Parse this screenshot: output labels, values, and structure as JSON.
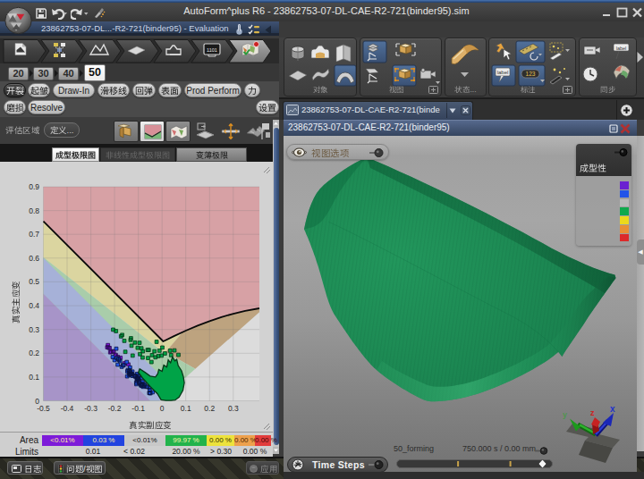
{
  "window": {
    "title": "AutoForm^plus R6 - 23862753-07-DL-CAE-R2-721(binder95).sim",
    "controls": {
      "minimize": "–",
      "maximize": "□",
      "close": "✕"
    }
  },
  "quick_toolbar": {
    "icons": [
      "save",
      "undo",
      "redo",
      "reset-highlights"
    ]
  },
  "eval_bar": {
    "title": "23862753-07-DL...-R2-721(binder95) - Evaluation"
  },
  "process_steps": [
    "input-files",
    "process-plan",
    "part",
    "blank",
    "tool-setup",
    "simulation-1101",
    "results-evaluation"
  ],
  "process_monitor_text": "1101",
  "stage_tabs": {
    "items": [
      "20",
      "30",
      "40",
      "50"
    ],
    "active": "50"
  },
  "result_buttons": {
    "row1": [
      {
        "label": "开裂",
        "active": true
      },
      {
        "label": "起皱",
        "active": false
      },
      {
        "label": "Draw-In",
        "active": false
      },
      {
        "label": "滑移线",
        "active": false
      },
      {
        "label": "回弹",
        "active": false
      },
      {
        "label": "表面",
        "active": false
      },
      {
        "label": "Prod Perform",
        "active": false
      },
      {
        "label": "力",
        "active": false
      }
    ],
    "row2": [
      {
        "label": "磨损",
        "active": false
      },
      {
        "label": "Resolve",
        "active": false
      }
    ],
    "settings": "设置"
  },
  "eval_region": {
    "label": "评估区域",
    "define_button": "定义...",
    "icons": [
      "iso-view",
      "fld-diagram",
      "fld-map",
      "section-sheet",
      "section-cross",
      "smileys-sheet",
      "marker-flag"
    ]
  },
  "chart_tabs": [
    {
      "label": "成型极限图",
      "state": "active"
    },
    {
      "label": "非线性成型极限图",
      "state": "disabled"
    },
    {
      "label": "变薄极限",
      "state": "normal"
    }
  ],
  "chart_data": {
    "type": "scatter",
    "title": "成型极限图",
    "xlabel": "真实副应变",
    "ylabel": "真实主应变",
    "xlim": [
      -0.5,
      0.41
    ],
    "ylim": [
      0,
      0.9
    ],
    "xticks": [
      -0.5,
      -0.4,
      -0.3,
      -0.2,
      -0.1,
      0,
      0.1,
      0.2,
      0.3
    ],
    "yticks": [
      0,
      0.1,
      0.2,
      0.3,
      0.4,
      0.5,
      0.6,
      0.7,
      0.8,
      0.9
    ],
    "grid": true,
    "flc": [
      [
        -0.5,
        0.755
      ],
      [
        0.005,
        0.25
      ],
      [
        0.05,
        0.272
      ],
      [
        0.1,
        0.295
      ],
      [
        0.15,
        0.316
      ],
      [
        0.2,
        0.335
      ],
      [
        0.25,
        0.352
      ],
      [
        0.3,
        0.366
      ],
      [
        0.35,
        0.378
      ],
      [
        0.41,
        0.389
      ]
    ],
    "regions": [
      {
        "name": "splits",
        "color": "#d7a1a5",
        "points": [
          [
            -0.5,
            0.9
          ],
          [
            -0.5,
            0.755
          ],
          [
            0.005,
            0.25
          ],
          [
            0.05,
            0.272
          ],
          [
            0.1,
            0.295
          ],
          [
            0.15,
            0.316
          ],
          [
            0.2,
            0.335
          ],
          [
            0.25,
            0.352
          ],
          [
            0.3,
            0.366
          ],
          [
            0.35,
            0.378
          ],
          [
            0.41,
            0.389
          ],
          [
            0.41,
            0.9
          ]
        ]
      },
      {
        "name": "risk-of-splits-left",
        "color": "#dbd5a0",
        "points": [
          [
            -0.5,
            0.755
          ],
          [
            0.005,
            0.25
          ],
          [
            0.01,
            0.2
          ],
          [
            -0.5,
            0.604
          ]
        ]
      },
      {
        "name": "risk-of-splits-right",
        "color": "#dbd5a0",
        "points": [
          [
            0.005,
            0.25
          ],
          [
            0.05,
            0.272
          ],
          [
            0.085,
            0.287
          ],
          [
            0.015,
            0.205
          ],
          [
            0.01,
            0.2
          ]
        ]
      },
      {
        "name": "bending",
        "color": "#bda37f",
        "points": [
          [
            0.085,
            0.287
          ],
          [
            0.1,
            0.295
          ],
          [
            0.15,
            0.316
          ],
          [
            0.2,
            0.335
          ],
          [
            0.25,
            0.352
          ],
          [
            0.3,
            0.366
          ],
          [
            0.35,
            0.378
          ],
          [
            0.41,
            0.389
          ],
          [
            0.41,
            0.373
          ],
          [
            0.14,
            0.134
          ],
          [
            0.015,
            0.205
          ]
        ]
      },
      {
        "name": "safe",
        "color": "#a9cdaa",
        "points": [
          [
            -0.5,
            0.604
          ],
          [
            0.01,
            0.2
          ],
          [
            0.015,
            0.205
          ],
          [
            0.14,
            0.134
          ],
          [
            -0.011,
            0
          ],
          [
            -0.5,
            0
          ]
        ]
      },
      {
        "name": "compression",
        "color": "#a6b1d8",
        "points": [
          [
            -0.5,
            0.6
          ],
          [
            0,
            0.1
          ],
          [
            0.048,
            0.052
          ],
          [
            -0.011,
            0
          ],
          [
            -0.05,
            0
          ],
          [
            -0.5,
            0.45
          ]
        ]
      },
      {
        "name": "wrinkles",
        "color": "#a794c8",
        "points": [
          [
            -0.5,
            0.45
          ],
          [
            -0.05,
            0
          ],
          [
            -0.5,
            0
          ]
        ]
      }
    ],
    "series": [
      {
        "name": "wrinkles",
        "color": "#7d14dc",
        "edge": "#2a0a50",
        "points": [
          [
            -0.204,
            0.207
          ],
          [
            -0.228,
            0.234
          ],
          [
            -0.184,
            0.178
          ],
          [
            -0.187,
            0.185
          ],
          [
            -0.231,
            0.225
          ],
          [
            -0.226,
            0.224
          ],
          [
            -0.195,
            0.193
          ],
          [
            -0.214,
            0.206
          ],
          [
            -0.175,
            0.181
          ],
          [
            -0.197,
            0.19
          ],
          [
            -0.142,
            0.153
          ],
          [
            -0.207,
            0.208
          ],
          [
            -0.221,
            0.222
          ],
          [
            -0.157,
            0.158
          ],
          [
            -0.218,
            0.204
          ]
        ]
      },
      {
        "name": "compression",
        "color": "#2153e8",
        "edge": "#0a1440",
        "points": [
          [
            -0.146,
            0.124
          ],
          [
            -0.114,
            0.106
          ],
          [
            -0.177,
            0.167
          ],
          [
            -0.089,
            0.066
          ],
          [
            -0.107,
            0.1
          ],
          [
            -0.131,
            0.112
          ],
          [
            -0.086,
            0.097
          ],
          [
            -0.17,
            0.143
          ],
          [
            -0.053,
            0.033
          ],
          [
            -0.08,
            0.059
          ],
          [
            -0.193,
            0.219
          ],
          [
            -0.138,
            0.126
          ],
          [
            -0.125,
            0.105
          ],
          [
            -0.208,
            0.184
          ],
          [
            -0.109,
            0.076
          ],
          [
            -0.053,
            0.033
          ],
          [
            -0.105,
            0.113
          ],
          [
            -0.108,
            0.07
          ],
          [
            -0.04,
            0.036
          ],
          [
            -0.127,
            0.113
          ],
          [
            -0.085,
            0.069
          ],
          [
            -0.095,
            0.109
          ],
          [
            -0.162,
            0.149
          ],
          [
            -0.144,
            0.13
          ],
          [
            -0.13,
            0.115
          ],
          [
            -0.184,
            0.176
          ],
          [
            -0.073,
            0.064
          ],
          [
            -0.191,
            0.179
          ],
          [
            -0.054,
            0.056
          ],
          [
            -0.2,
            0.171
          ],
          [
            -0.052,
            0.045
          ],
          [
            -0.063,
            0.059
          ],
          [
            -0.138,
            0.118
          ],
          [
            -0.149,
            0.163
          ],
          [
            -0.187,
            0.152
          ],
          [
            -0.182,
            0.172
          ],
          [
            -0.125,
            0.123
          ],
          [
            -0.106,
            0.094
          ],
          [
            -0.137,
            0.127
          ],
          [
            -0.147,
            0.103
          ],
          [
            -0.135,
            0.112
          ],
          [
            -0.139,
            0.108
          ],
          [
            -0.135,
            0.14
          ],
          [
            -0.084,
            0.07
          ],
          [
            -0.165,
            0.15
          ],
          [
            -0.134,
            0.111
          ],
          [
            -0.097,
            0.076
          ],
          [
            -0.113,
            0.102
          ],
          [
            -0.097,
            0.084
          ],
          [
            -0.082,
            0.064
          ],
          [
            -0.105,
            0.09
          ],
          [
            -0.094,
            0.074
          ],
          [
            -0.1,
            0.093
          ],
          [
            -0.134,
            0.121
          ],
          [
            -0.087,
            0.063
          ],
          [
            -0.082,
            0.079
          ],
          [
            -0.064,
            0.059
          ],
          [
            -0.106,
            0.084
          ],
          [
            -0.104,
            0.094
          ],
          [
            -0.089,
            0.069
          ],
          [
            -0.049,
            0.032
          ],
          [
            -0.099,
            0.094
          ],
          [
            -0.116,
            0.106
          ],
          [
            -0.075,
            0.07
          ],
          [
            -0.099,
            0.103
          ]
        ]
      },
      {
        "name": "safe",
        "color": "#00a347",
        "edge": "#063818",
        "points": [
          [
            -0.206,
            0.299
          ],
          [
            -0.194,
            0.293
          ],
          [
            -0.173,
            0.271
          ],
          [
            -0.168,
            0.277
          ],
          [
            -0.159,
            0.252
          ],
          [
            -0.133,
            0.256
          ],
          [
            -0.131,
            0.263
          ],
          [
            -0.129,
            0.232
          ],
          [
            -0.114,
            0.245
          ],
          [
            -0.103,
            0.223
          ],
          [
            -0.095,
            0.244
          ],
          [
            -0.081,
            0.208
          ],
          [
            -0.087,
            0.221
          ],
          [
            -0.061,
            0.214
          ],
          [
            -0.056,
            0.214
          ],
          [
            -0.042,
            0.192
          ],
          [
            -0.032,
            0.208
          ],
          [
            -0.023,
            0.248
          ],
          [
            -0.028,
            0.183
          ],
          [
            -0.011,
            0.211
          ],
          [
            -0.002,
            0.19
          ],
          [
            0.001,
            0.224
          ],
          [
            0.012,
            0.199
          ],
          [
            0.034,
            0.211
          ],
          [
            -0.124,
            0.19
          ],
          [
            -0.155,
            0.206
          ],
          [
            -0.059,
            0.18
          ],
          [
            -0.045,
            0.163
          ],
          [
            0.052,
            0.212
          ],
          [
            0.069,
            0.193
          ],
          [
            -0.093,
            0.196
          ],
          [
            -0.082,
            0.182
          ],
          [
            0.038,
            0.192
          ],
          [
            -0.016,
            0.188
          ]
        ]
      },
      {
        "name": "safe-cluster",
        "color": "#00a347",
        "edge": "#063818",
        "outline": [
          [
            -0.004,
            0.004
          ],
          [
            -0.02,
            0.03
          ],
          [
            -0.05,
            0.06
          ],
          [
            -0.082,
            0.096
          ],
          [
            -0.1,
            0.12
          ],
          [
            -0.094,
            0.134
          ],
          [
            -0.072,
            0.12
          ],
          [
            -0.05,
            0.104
          ],
          [
            -0.028,
            0.1
          ],
          [
            -0.018,
            0.114
          ],
          [
            -0.014,
            0.132
          ],
          [
            0.0,
            0.124
          ],
          [
            0.007,
            0.15
          ],
          [
            0.02,
            0.142
          ],
          [
            0.026,
            0.172
          ],
          [
            0.036,
            0.16
          ],
          [
            0.044,
            0.185
          ],
          [
            0.054,
            0.168
          ],
          [
            0.062,
            0.174
          ],
          [
            0.068,
            0.148
          ],
          [
            0.082,
            0.126
          ],
          [
            0.09,
            0.1
          ],
          [
            0.094,
            0.076
          ],
          [
            0.088,
            0.044
          ],
          [
            0.072,
            0.016
          ],
          [
            0.055,
            0.003
          ],
          [
            0.038,
            0.001
          ],
          [
            0.016,
            0.001
          ]
        ]
      }
    ]
  },
  "legend_table": {
    "area_label": "Area",
    "limits_label": "Limits",
    "cells": [
      {
        "area": "<0.01%",
        "color": "#7d1bd9",
        "text": "#ffef9a"
      },
      {
        "area": "0.03 %",
        "color": "#2244e0",
        "text": "#ffef9a"
      },
      {
        "area": "<0.01%",
        "color": "#c8c8c8",
        "text": "#111111"
      },
      {
        "area": "99.97 %",
        "color": "#22b34b",
        "text": "#fdf6b0"
      },
      {
        "area": "0.00 %",
        "color": "#ede23c",
        "text": "#333300"
      },
      {
        "area": "0.00 %",
        "color": "#eda04c",
        "text": "#4a2800"
      },
      {
        "area": "0.00 %",
        "color": "#e23c3c",
        "text": "#3d0808"
      }
    ],
    "limits": [
      "0.01",
      "< 0.02",
      "",
      "20.00 %",
      "> 0.30",
      "0.00 %"
    ]
  },
  "bottom_bar": {
    "log": "日志",
    "issues": "问题/视图",
    "apply": "应用"
  },
  "ribbon": {
    "groups": [
      {
        "label": "对象",
        "icons": [
          "stock",
          "binder",
          "pages",
          "flat-sheet",
          "curved-sheet",
          "dome-sheet"
        ]
      },
      {
        "label": "视图",
        "icons": [
          "layers-axes",
          "cube-frame",
          "sheet-axes",
          "cube-frame-orange",
          "camera"
        ]
      },
      {
        "label": "状态...",
        "icons": [
          "part-state"
        ]
      },
      {
        "label": "标注",
        "icons": [
          "cursor",
          "ruler",
          "wand-stars",
          "label-tag",
          "numbers",
          "wand-stars-2"
        ]
      },
      {
        "label": "同步",
        "icons": [
          "camera-sync",
          "label-pin",
          "clock",
          "result-map"
        ]
      }
    ]
  },
  "viewport": {
    "tab": {
      "label": "23862753-07-DL-CAE-R2-721(binde",
      "close": "✕"
    },
    "add_view": "+",
    "window_title": "23862753-07-DL-CAE-R2-721(binder95)",
    "window_controls": {
      "restore": "□",
      "close": "✕"
    },
    "view_options": "视图选项",
    "legend": {
      "title": "成型性",
      "colors": [
        "#6a21d0",
        "#2153e8",
        "#b9b9b9",
        "#10a94d",
        "#ecd91c",
        "#e88f35",
        "#dc2a2a"
      ]
    },
    "time_steps": "Time Steps",
    "step_label": "50_forming",
    "time_label": "750.000 s / 0.00 mm",
    "slider": {
      "tick_positions": [
        0.39,
        0.74
      ],
      "handle_position": 0.955
    },
    "triad": {
      "x_label": "x",
      "y_label": "y",
      "z_label": "z",
      "x_color": "#2233cc",
      "y_color": "#22aa22",
      "z_color": "#cc2222"
    }
  }
}
